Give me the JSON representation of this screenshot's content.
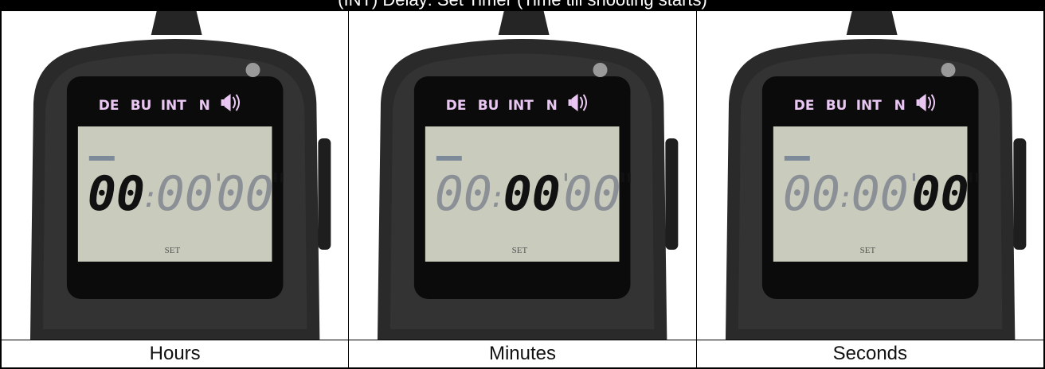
{
  "title": "(INT) Delay: Set Timer (Time till shooting starts)",
  "panels": [
    {
      "caption": "Hours",
      "icons": [
        "DE",
        "BU",
        "INT",
        "N"
      ],
      "speaker_icon": "speaker-icon",
      "lcd": {
        "hours": "00",
        "minutes": "00",
        "seconds": "00",
        "sep1": ":",
        "sep2": "'",
        "sep3": "\"",
        "highlight": "hours",
        "label": "SET"
      }
    },
    {
      "caption": "Minutes",
      "icons": [
        "DE",
        "BU",
        "INT",
        "N"
      ],
      "speaker_icon": "speaker-icon",
      "lcd": {
        "hours": "00",
        "minutes": "00",
        "seconds": "00",
        "sep1": ":",
        "sep2": "'",
        "sep3": "\"",
        "highlight": "minutes",
        "label": "SET"
      }
    },
    {
      "caption": "Seconds",
      "icons": [
        "DE",
        "BU",
        "INT",
        "N"
      ],
      "speaker_icon": "speaker-icon",
      "lcd": {
        "hours": "00",
        "minutes": "00",
        "seconds": "00",
        "sep1": ":",
        "sep2": "'",
        "sep3": "\"",
        "highlight": "seconds",
        "label": "SET"
      }
    }
  ],
  "colors": {
    "lcd_bg": "#c9ccbd",
    "icon_text": "#e9c7f2",
    "body": "#2b2b2b",
    "digit_active": "#111111",
    "digit_dim": "#8b9096"
  }
}
